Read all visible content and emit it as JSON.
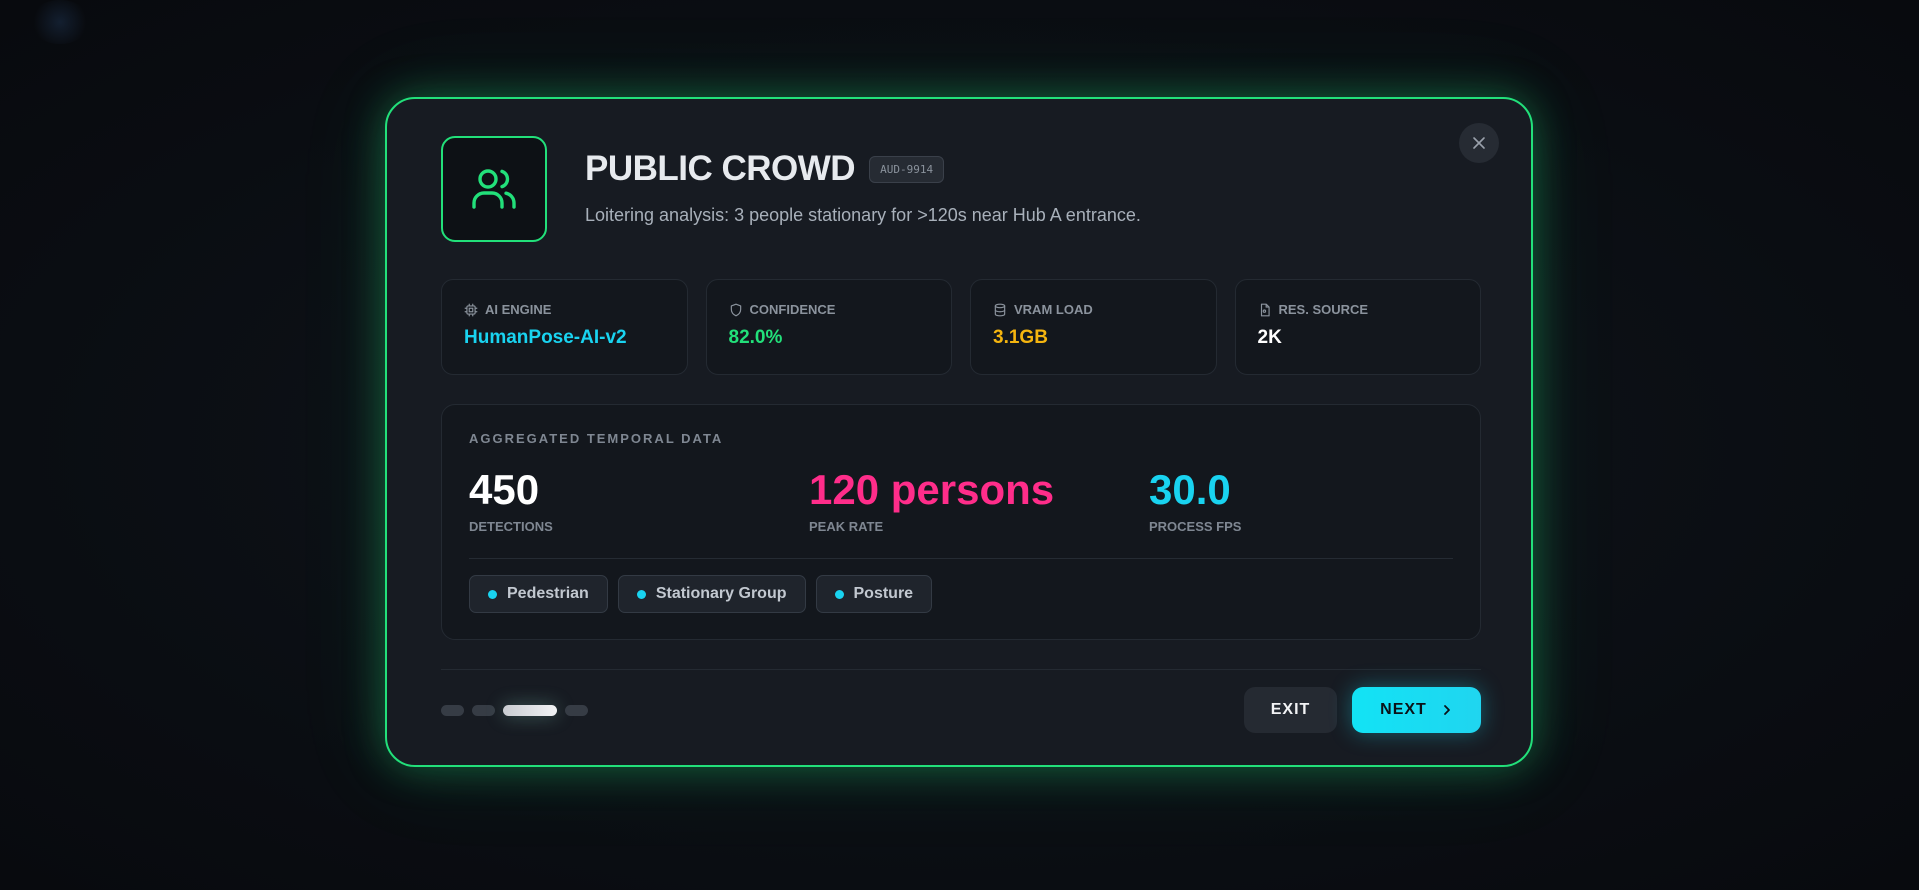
{
  "header": {
    "title": "PUBLIC CROWD",
    "badge": "AUD-9914",
    "subtitle": "Loitering analysis: 3 people stationary for >120s near Hub A entrance."
  },
  "stats": [
    {
      "label": "AI ENGINE",
      "value": "HumanPose-AI-v2",
      "icon": "cpu-icon",
      "color": "#19d3f0"
    },
    {
      "label": "CONFIDENCE",
      "value": "82.0%",
      "icon": "shield-icon",
      "color": "#22e07a"
    },
    {
      "label": "VRAM LOAD",
      "value": "3.1GB",
      "icon": "database-icon",
      "color": "#f5b50f"
    },
    {
      "label": "RES. SOURCE",
      "value": "2K",
      "icon": "file-icon",
      "color": "#ffffff"
    }
  ],
  "temporal": {
    "title": "AGGREGATED TEMPORAL DATA",
    "metrics": [
      {
        "value": "450",
        "label": "DETECTIONS",
        "color": "#ffffff"
      },
      {
        "value": "120 persons",
        "label": "PEAK RATE",
        "color": "#ff2d8a"
      },
      {
        "value": "30.0",
        "label": "PROCESS FPS",
        "color": "#19d3f0"
      }
    ],
    "tags": [
      "Pedestrian",
      "Stationary Group",
      "Posture"
    ]
  },
  "footer": {
    "pager_total": 4,
    "pager_active": 3,
    "exit_label": "EXIT",
    "next_label": "NEXT"
  },
  "colors": {
    "accent_green": "#22e07a",
    "accent_cyan": "#19d3f0"
  }
}
